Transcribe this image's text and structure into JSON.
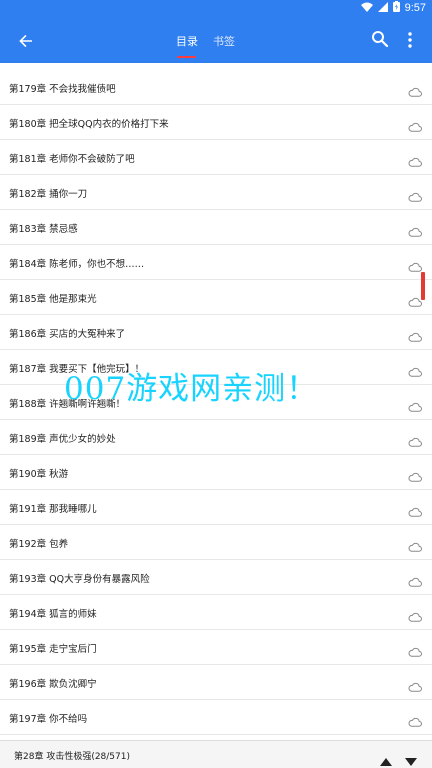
{
  "status_bar": {
    "time": "9:57"
  },
  "header": {
    "tabs": [
      {
        "label": "目录",
        "active": true
      },
      {
        "label": "书签",
        "active": false
      }
    ],
    "accent_color": "#2f7ff0",
    "indicator_color": "#ff3b3b"
  },
  "chapters": [
    "第179章 不会找我催债吧",
    "第180章 把全球QQ内衣的价格打下来",
    "第181章 老师你不会破防了吧",
    "第182章 捅你一刀",
    "第183章 禁忌感",
    "第184章 陈老师，你也不想……",
    "第185章 他是那束光",
    "第186章 买店的大冤种来了",
    "第187章 我要买下【他完玩】！",
    "第188章 许翘嘶啊许翘嘶！",
    "第189章 声优少女的妙处",
    "第190章 秋游",
    "第191章 那我睡哪儿",
    "第192章 包养",
    "第193章 QQ大亨身份有暴露风险",
    "第194章 狐言的师妹",
    "第195章 走宁宝后门",
    "第196章 欺负沈卿宁",
    "第197章 你不给吗"
  ],
  "watermark": "007游戏网亲测！",
  "bottom": {
    "current_chapter": "第28章 攻击性极强(28/571)"
  },
  "icons": {
    "back": "arrow-left-icon",
    "search": "search-icon",
    "more": "more-vert-icon",
    "cloud": "cloud-icon",
    "up": "arrow-up-icon",
    "down": "arrow-down-icon"
  }
}
